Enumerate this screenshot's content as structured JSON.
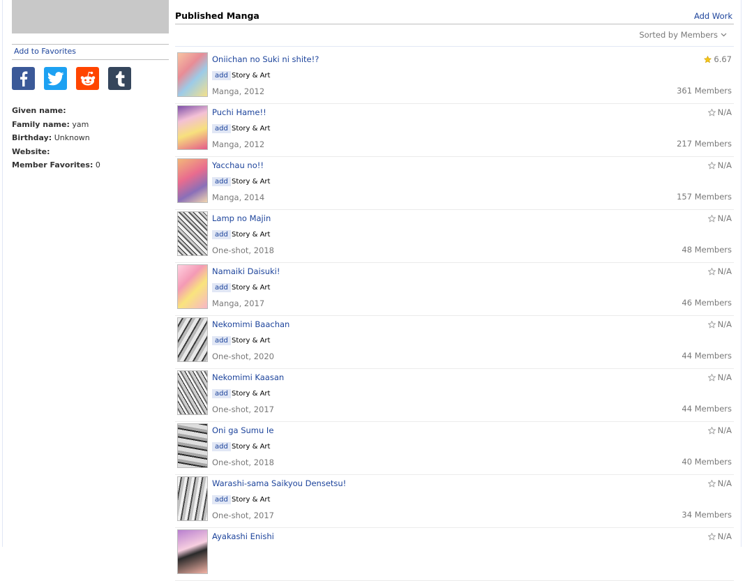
{
  "sidebar": {
    "add_to_favorites": "Add to Favorites",
    "share_icons": [
      "facebook-icon",
      "twitter-icon",
      "reddit-icon",
      "tumblr-icon"
    ],
    "info": [
      {
        "label": "Given name:",
        "value": ""
      },
      {
        "label": "Family name:",
        "value": "yam"
      },
      {
        "label": "Birthday:",
        "value": "Unknown"
      },
      {
        "label": "Website:",
        "value": ""
      },
      {
        "label": "Member Favorites:",
        "value": "0"
      }
    ]
  },
  "main": {
    "section_title": "Published Manga",
    "add_work_label": "Add Work",
    "sort_label": "Sorted by Members",
    "add_tag": "add",
    "entries": [
      {
        "title": "Oniichan no Suki ni shite!?",
        "role": "Story & Art",
        "meta": "Manga, 2012",
        "members": "361 Members",
        "score": "6.67",
        "scored": true,
        "cover": "cv-color-a"
      },
      {
        "title": "Puchi Hame!!",
        "role": "Story & Art",
        "meta": "Manga, 2012",
        "members": "217 Members",
        "score": "N/A",
        "scored": false,
        "cover": "cv-color-b"
      },
      {
        "title": "Yacchau no!!",
        "role": "Story & Art",
        "meta": "Manga, 2014",
        "members": "157 Members",
        "score": "N/A",
        "scored": false,
        "cover": "cv-color-c"
      },
      {
        "title": "Lamp no Majin",
        "role": "Story & Art",
        "meta": "One-shot, 2018",
        "members": "48 Members",
        "score": "N/A",
        "scored": false,
        "cover": "cv-bw-a"
      },
      {
        "title": "Namaiki Daisuki!",
        "role": "Story & Art",
        "meta": "Manga, 2017",
        "members": "46 Members",
        "score": "N/A",
        "scored": false,
        "cover": "cv-color-d"
      },
      {
        "title": "Nekomimi Baachan",
        "role": "Story & Art",
        "meta": "One-shot, 2020",
        "members": "44 Members",
        "score": "N/A",
        "scored": false,
        "cover": "cv-bw-b"
      },
      {
        "title": "Nekomimi Kaasan",
        "role": "Story & Art",
        "meta": "One-shot, 2017",
        "members": "44 Members",
        "score": "N/A",
        "scored": false,
        "cover": "cv-bw-c"
      },
      {
        "title": "Oni ga Sumu Ie",
        "role": "Story & Art",
        "meta": "One-shot, 2018",
        "members": "40 Members",
        "score": "N/A",
        "scored": false,
        "cover": "cv-bw-d"
      },
      {
        "title": "Warashi-sama Saikyou Densetsu!",
        "role": "Story & Art",
        "meta": "One-shot, 2017",
        "members": "34 Members",
        "score": "N/A",
        "scored": false,
        "cover": "cv-bw-e"
      },
      {
        "title": "Ayakashi Enishi",
        "role": "",
        "meta": "",
        "members": "",
        "score": "N/A",
        "scored": false,
        "cover": "cv-color-e"
      }
    ]
  },
  "colors": {
    "link": "#1c439b",
    "star_filled": "#f5c518",
    "star_empty": "#9a9a9a",
    "muted": "#787878"
  }
}
